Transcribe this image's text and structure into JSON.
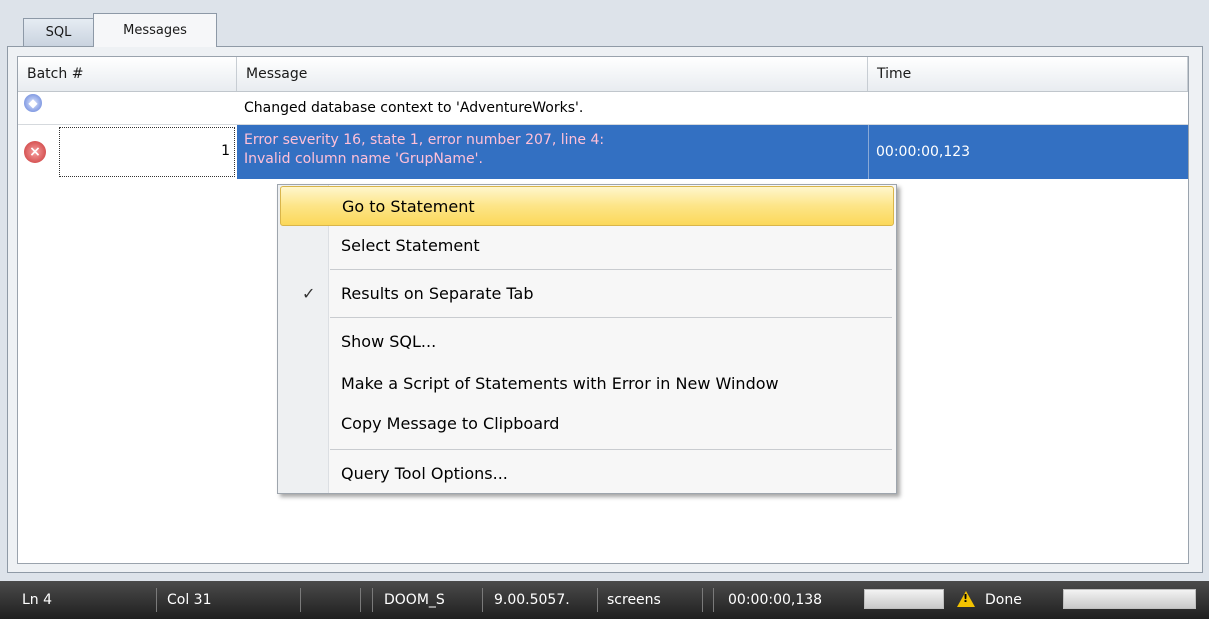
{
  "tabs": [
    {
      "label": "SQL"
    },
    {
      "label": "Messages",
      "active": true
    }
  ],
  "grid": {
    "columns": [
      "Batch #",
      "Message",
      "Time"
    ],
    "rows": [
      {
        "icon": "info-icon",
        "batch": "",
        "message": [
          "Changed database context to 'AdventureWorks'."
        ],
        "time": ""
      },
      {
        "icon": "error-icon",
        "batch": "1",
        "message": [
          "Error severity 16, state 1, error number 207, line 4:",
          "Invalid column name 'GrupName'."
        ],
        "time": "00:00:00,123",
        "selected": true
      }
    ]
  },
  "context_menu": {
    "items": [
      {
        "label": "Go to Statement",
        "highlighted": true
      },
      {
        "label": "Select Statement"
      },
      {
        "label": "Results on Separate Tab",
        "checked": true,
        "check_glyph": "✓"
      },
      {
        "label": "Show SQL..."
      },
      {
        "label": "Make a Script of Statements with Error in New Window"
      },
      {
        "label": "Copy Message to Clipboard"
      },
      {
        "label": "Query Tool Options..."
      }
    ]
  },
  "statusbar": {
    "line": "Ln 4",
    "column": "Col 31",
    "server": "DOOM_S",
    "version": "9.00.5057.",
    "database": "screens",
    "elapsed": "00:00:00,138",
    "state": "Done"
  },
  "colors": {
    "selection": "#3370c2",
    "error_text": "#ffc0d8",
    "menu_highlight": "#fde587"
  }
}
